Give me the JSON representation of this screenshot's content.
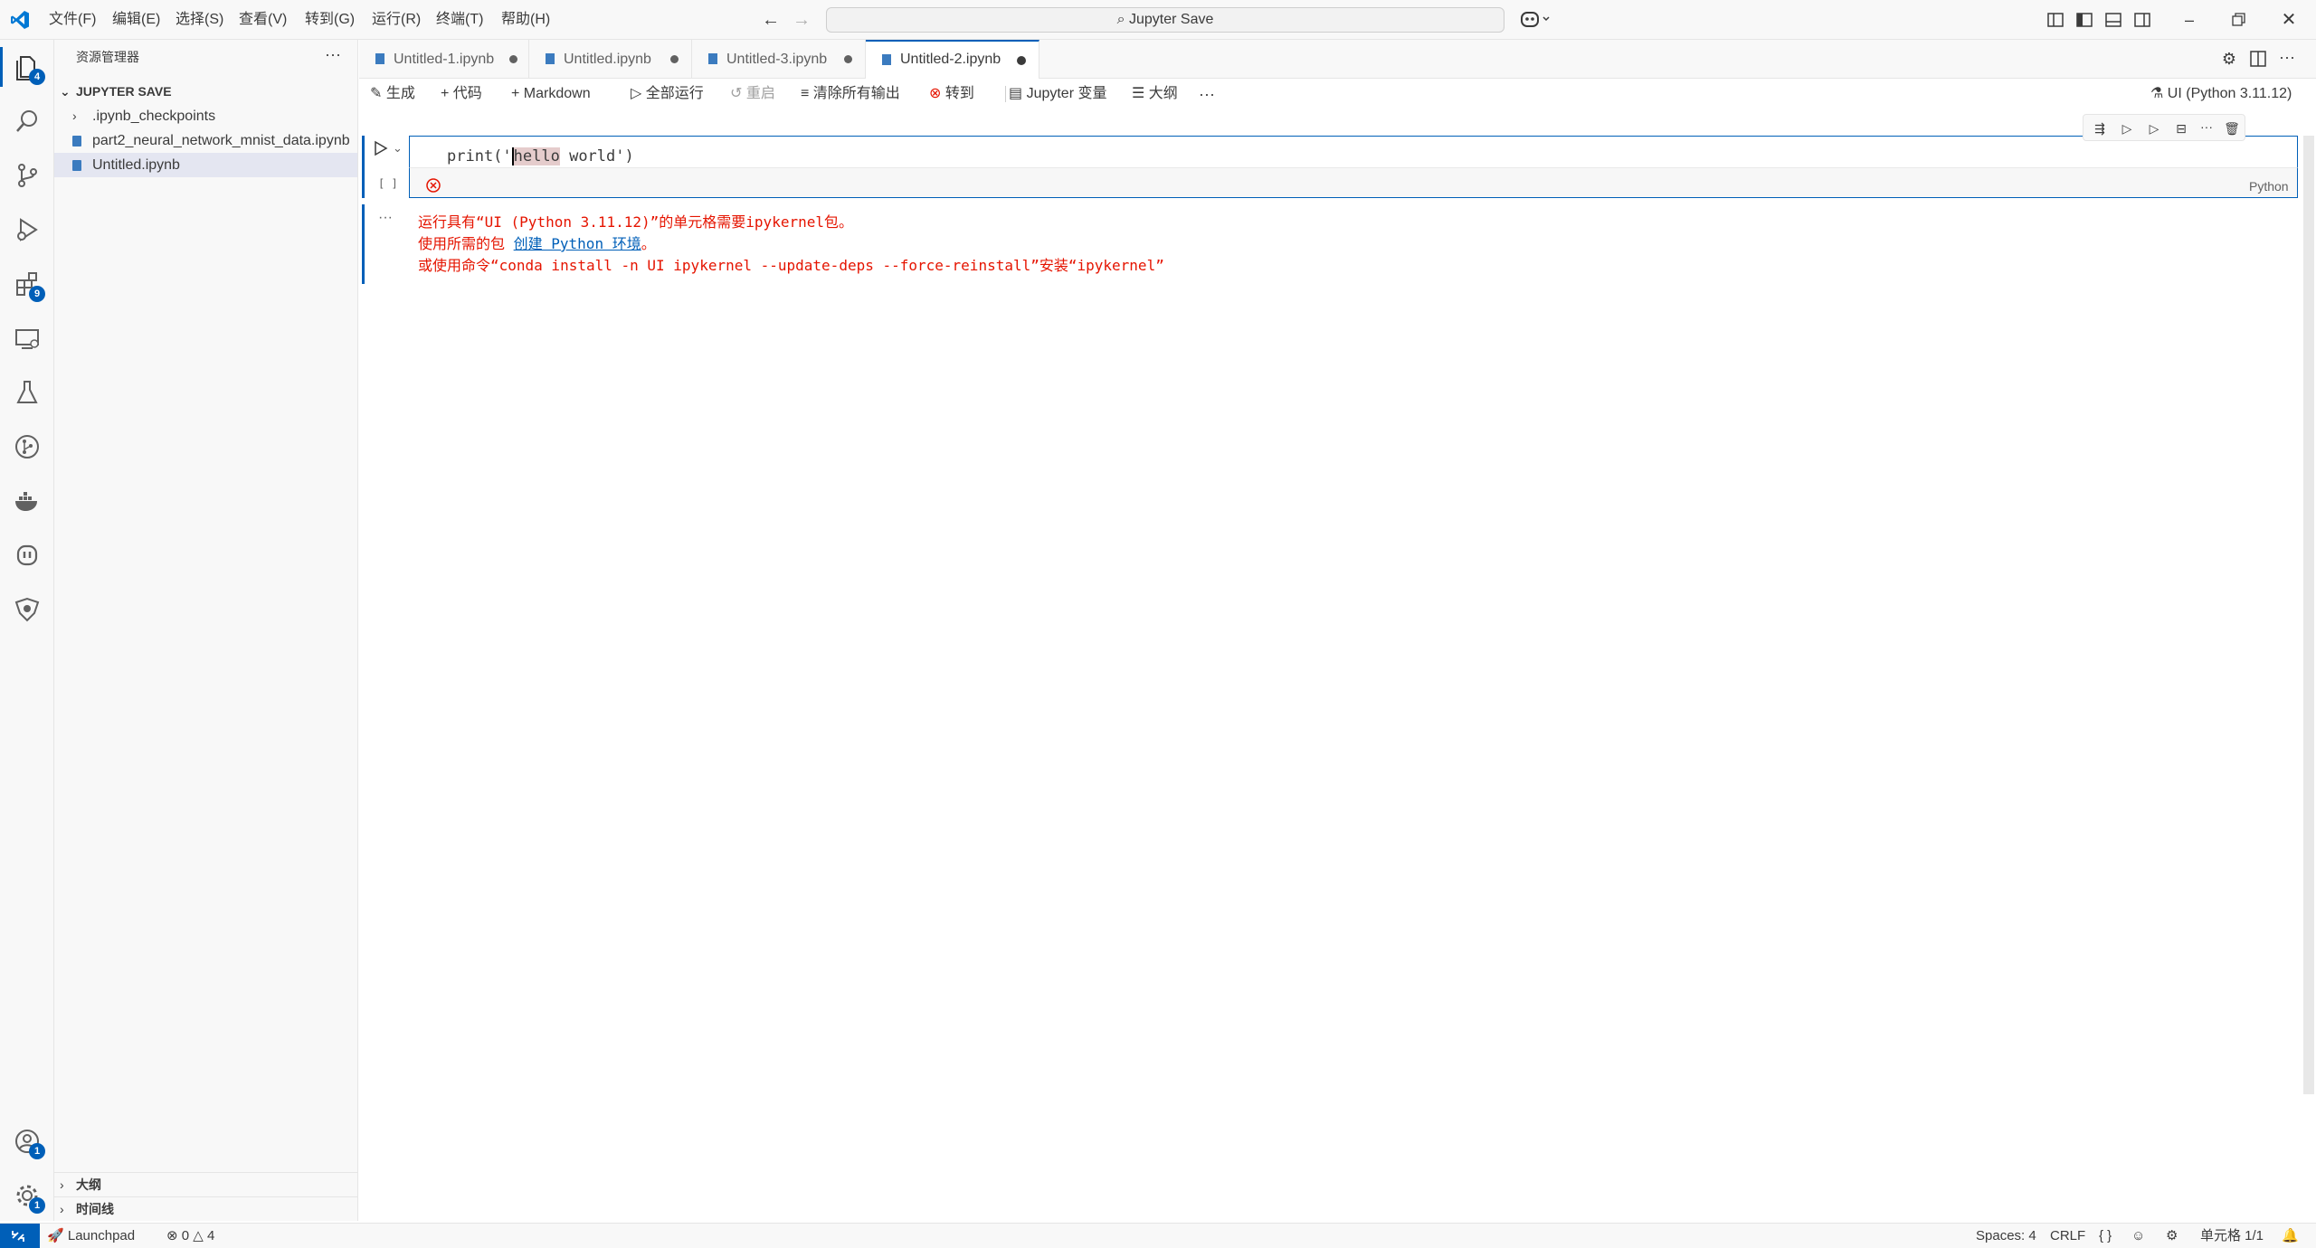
{
  "titlebar": {
    "menus": [
      "文件(F)",
      "编辑(E)",
      "选择(S)",
      "查看(V)",
      "转到(G)",
      "运行(R)",
      "终端(T)",
      "帮助(H)"
    ],
    "search_text": "Jupyter Save"
  },
  "activity_bar": {
    "explorer_badge": "4",
    "extensions_badge": "9",
    "accounts_badge": "1",
    "settings_badge": "1"
  },
  "sidebar": {
    "title": "资源管理器",
    "folder": "JUPYTER SAVE",
    "items": [
      {
        "label": ".ipynb_checkpoints",
        "type": "folder"
      },
      {
        "label": "part2_neural_network_mnist_data.ipynb",
        "type": "file"
      },
      {
        "label": "Untitled.ipynb",
        "type": "file"
      }
    ],
    "outline": "大纲",
    "timeline": "时间线"
  },
  "tabs": [
    {
      "label": "Untitled-1.ipynb",
      "active": false
    },
    {
      "label": "Untitled.ipynb",
      "active": false
    },
    {
      "label": "Untitled-3.ipynb",
      "active": false
    },
    {
      "label": "Untitled-2.ipynb",
      "active": true
    }
  ],
  "nb_toolbar": {
    "generate": "生成",
    "code": "代码",
    "markdown": "Markdown",
    "run_all": "全部运行",
    "restart": "重启",
    "clear_outputs": "清除所有输出",
    "goto": "转到",
    "variables": "Jupyter 变量",
    "outline": "大纲",
    "kernel": "UI (Python 3.11.12)"
  },
  "cell": {
    "code_before": "print('",
    "code_highlight": "hello",
    "code_after": " world')",
    "exec_count": "[ ]",
    "language": "Python",
    "output_line1": "运行具有“UI (Python 3.11.12)”的单元格需要ipykernel包。",
    "output_line2_pre": "使用所需的包 ",
    "output_line2_link": "创建 Python 环境",
    "output_line2_post": "。",
    "output_line3": "或使用命令“conda install -n UI ipykernel --update-deps --force-reinstall”安装“ipykernel”"
  },
  "statusbar": {
    "launchpad": "Launchpad",
    "errors": "0",
    "warnings": "4",
    "spaces": "Spaces: 4",
    "eol": "CRLF",
    "cell_pos": "单元格 1/1"
  },
  "colors": {
    "accent": "#005fb8",
    "error": "#e51400"
  }
}
